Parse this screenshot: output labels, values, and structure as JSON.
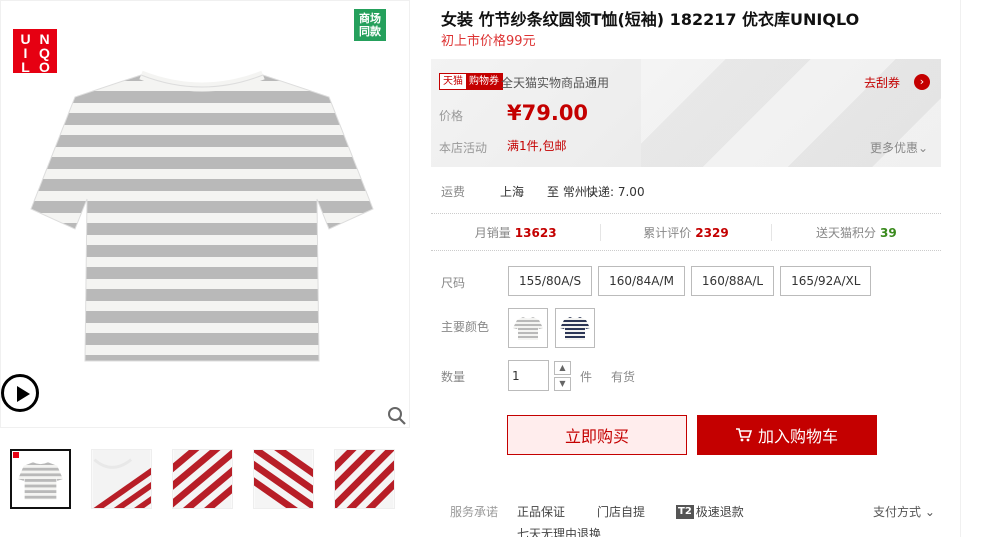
{
  "gallery": {
    "brand_logo_letters": [
      "U",
      "N",
      "I",
      "Q",
      "L",
      "O"
    ],
    "store_badge": "商场同款",
    "play_icon": "play-icon",
    "zoom_icon": "magnifier-icon",
    "thumbnails": [
      {
        "name": "thumb-grey-white-tee",
        "selected": true
      },
      {
        "name": "thumb-red-white-tee-collar",
        "selected": false
      },
      {
        "name": "thumb-red-white-stripes-1",
        "selected": false
      },
      {
        "name": "thumb-red-white-stripes-2",
        "selected": false
      },
      {
        "name": "thumb-red-white-stripes-3",
        "selected": false
      }
    ]
  },
  "product": {
    "title": "女装 竹节纱条纹圆领T恤(短袖) 182217 优衣库UNIQLO",
    "original_price_text": "初上市价格99元"
  },
  "price_box": {
    "tag_a": "天猫",
    "tag_b": "购物券",
    "coupon_text": "全天猫实物商品通用",
    "coupon_link": "去刮券",
    "coupon_arrow": "›",
    "price_label": "价格",
    "price_value": "¥79.00",
    "promo_label": "本店活动",
    "promo_value": "满1件,包邮",
    "more_promo": "更多优惠"
  },
  "shipping": {
    "label": "运费",
    "from": "上海",
    "to": "至 常州",
    "fee": "快递: 7.00"
  },
  "stats": {
    "monthly_sales_label": "月销量",
    "monthly_sales_value": "13623",
    "reviews_label": "累计评价",
    "reviews_value": "2329",
    "points_label": "送天猫积分",
    "points_value": "39"
  },
  "options": {
    "size_label": "尺码",
    "sizes": [
      "155/80A/S",
      "160/84A/M",
      "160/88A/L",
      "165/92A/XL"
    ],
    "color_label": "主要颜色",
    "color_swatches": [
      "grey-white-stripe",
      "navy-white-stripe"
    ],
    "qty_label": "数量",
    "qty_value": "1",
    "qty_unit": "件",
    "stock": "有货"
  },
  "actions": {
    "buy_now": "立即购买",
    "add_cart": "加入购物车"
  },
  "service": {
    "label": "服务承诺",
    "items": [
      "正品保证",
      "门店自提",
      "极速退款",
      "七天无理由退换"
    ],
    "t2_badge": "T2",
    "pay_methods": "支付方式"
  },
  "colors": {
    "accent": "#c40000",
    "badge_green": "#25a05c",
    "logo_red": "#e60012"
  }
}
